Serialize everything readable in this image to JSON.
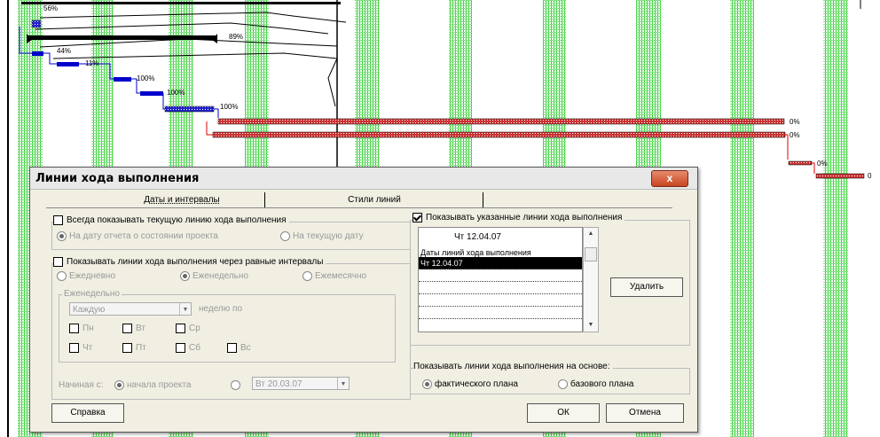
{
  "gantt": {
    "labels": {
      "l1": "56%",
      "l2": "89%",
      "l3": "44%",
      "l4": "11%",
      "l5": "100%",
      "l6": "100%",
      "l7": "100%",
      "l8": "0%",
      "l9": "0%",
      "l10": "0%",
      "l11": "0"
    },
    "colors": {
      "stripe": "#00cc00",
      "task": "#0000cc",
      "critical": "#dd0000",
      "summary": "#000000"
    }
  },
  "dialog": {
    "title": "Линии хода выполнения",
    "close_label": "x",
    "tabs": [
      "Даты и интервалы",
      "Стили линий"
    ],
    "left": {
      "always_show": "Всегда показывать текущую линию хода выполнения",
      "on_status_date": "На дату отчета о состоянии проекта",
      "on_current_date": "На текущую дату",
      "show_intervals": "Показывать линии хода выполнения через равные интервалы",
      "daily": "Ежедневно",
      "weekly": "Еженедельно",
      "monthly": "Ежемесячно",
      "weekly_group": "Еженедельно",
      "every_value": "Каждую",
      "week_on": "неделю по",
      "days": [
        "Пн",
        "Вт",
        "Ср",
        "Чт",
        "Пт",
        "Сб",
        "Вс"
      ],
      "start_label": "Начиная с:",
      "project_start": "начала проекта",
      "start_date": "Вт 20.03.07"
    },
    "right": {
      "show_selected": "Показывать указанные линии хода выполнения",
      "date_input": "Чт 12.04.07",
      "list_header": "Даты линий хода выполнения",
      "list_items": [
        "Чт 12.04.07",
        "",
        "",
        "",
        "",
        "",
        ""
      ],
      "delete_button": "Удалить",
      "based_on": "Показывать линии хода выполнения на основе:",
      "actual_plan": "фактического плана",
      "baseline_plan": "базового плана"
    },
    "buttons": {
      "help": "Справка",
      "ok": "ОК",
      "cancel": "Отмена"
    }
  }
}
